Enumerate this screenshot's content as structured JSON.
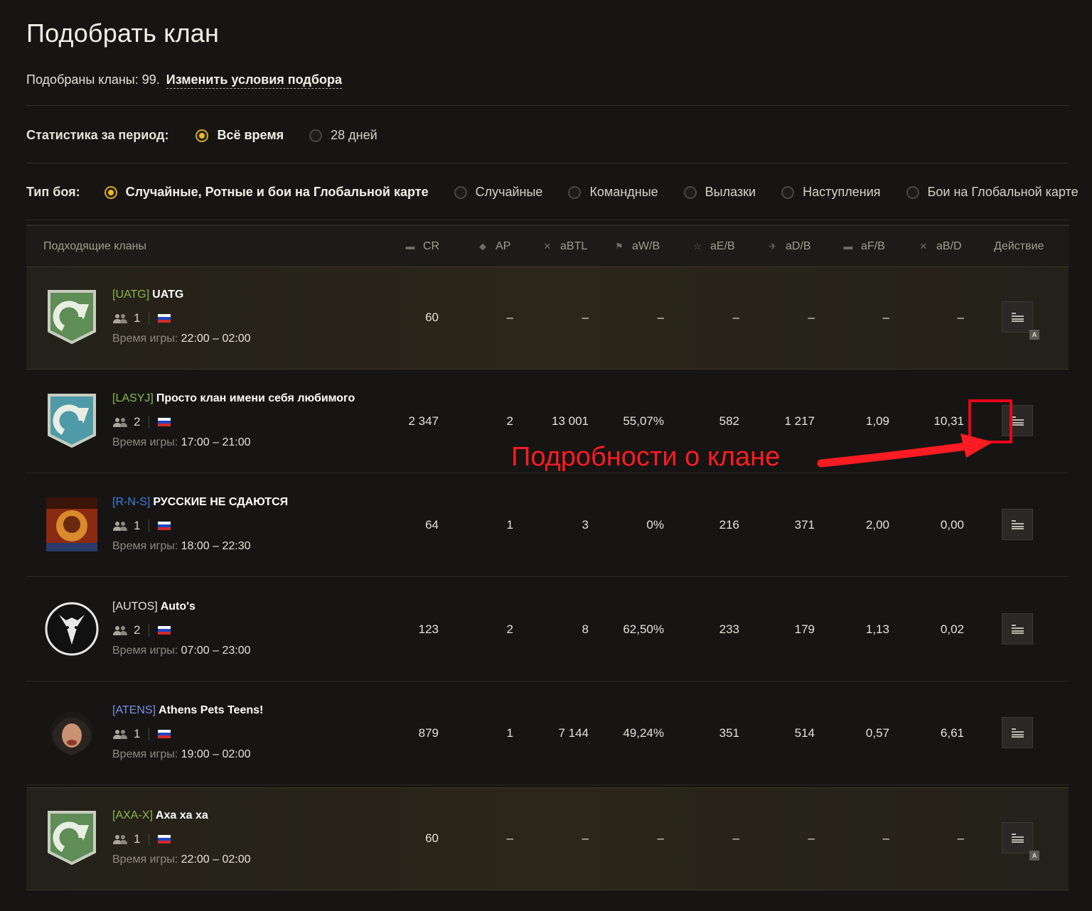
{
  "header": {
    "title": "Подобрать клан",
    "summary_prefix": "Подобраны кланы: 99.",
    "change_link": "Изменить условия подбора"
  },
  "period": {
    "label": "Статистика за период:",
    "options": [
      {
        "label": "Всё время",
        "checked": true
      },
      {
        "label": "28 дней",
        "checked": false
      }
    ]
  },
  "battle_type": {
    "label": "Тип боя:",
    "options": [
      {
        "label": "Случайные, Ротные и бои на Глобальной карте",
        "checked": true
      },
      {
        "label": "Случайные",
        "checked": false
      },
      {
        "label": "Командные",
        "checked": false
      },
      {
        "label": "Вылазки",
        "checked": false
      },
      {
        "label": "Наступления",
        "checked": false
      },
      {
        "label": "Бои на Глобальной карте",
        "checked": false
      }
    ]
  },
  "table": {
    "headers": {
      "clans": "Подходящие кланы",
      "cr": "CR",
      "ap": "AP",
      "abtl": "aBTL",
      "awb": "aW/B",
      "aeb": "aE/B",
      "adb": "aD/B",
      "afb": "aF/B",
      "abd": "aB/D",
      "action": "Действие"
    },
    "rows": [
      {
        "tag": "[UATG]",
        "name": "UATG",
        "tag_color": "#8ab84a",
        "members": "1",
        "time_label": "Время игры:",
        "time": "22:00 – 02:00",
        "cr": "60",
        "ap": "–",
        "abtl": "–",
        "awb": "–",
        "aeb": "–",
        "adb": "–",
        "afb": "–",
        "abd": "–",
        "highlight": true,
        "badge": "A",
        "emblem": "banner-green"
      },
      {
        "tag": "[LASYJ]",
        "name": "Просто клан имени себя любимого",
        "tag_color": "#8ab84a",
        "members": "2",
        "time_label": "Время игры:",
        "time": "17:00 – 21:00",
        "cr": "2 347",
        "ap": "2",
        "abtl": "13 001",
        "awb": "55,07%",
        "aeb": "582",
        "adb": "1 217",
        "afb": "1,09",
        "abd": "10,31",
        "highlight": false,
        "badge": "",
        "emblem": "banner-teal"
      },
      {
        "tag": "[R-N-S]",
        "name": "РУССКИЕ НЕ СДАЮТСЯ",
        "tag_color": "#3d7fe0",
        "members": "1",
        "time_label": "Время игры:",
        "time": "18:00 – 22:30",
        "cr": "64",
        "ap": "1",
        "abtl": "3",
        "awb": "0%",
        "aeb": "216",
        "adb": "371",
        "afb": "2,00",
        "abd": "0,00",
        "highlight": false,
        "badge": "",
        "emblem": "poster"
      },
      {
        "tag": "[AUTOS]",
        "name": "Auto's",
        "tag_color": "#e6e2d8",
        "members": "2",
        "time_label": "Время игры:",
        "time": "07:00 – 23:00",
        "cr": "123",
        "ap": "2",
        "abtl": "8",
        "awb": "62,50%",
        "aeb": "233",
        "adb": "179",
        "afb": "1,13",
        "abd": "0,02",
        "highlight": false,
        "badge": "",
        "emblem": "wolf"
      },
      {
        "tag": "[ATENS]",
        "name": "Athens Pets Teens!",
        "tag_color": "#7a8fe0",
        "members": "1",
        "time_label": "Время игры:",
        "time": "19:00 – 02:00",
        "cr": "879",
        "ap": "1",
        "abtl": "7 144",
        "awb": "49,24%",
        "aeb": "351",
        "adb": "514",
        "afb": "0,57",
        "abd": "6,61",
        "highlight": false,
        "badge": "",
        "emblem": "face"
      },
      {
        "tag": "[AXA-X]",
        "name": "Axa xa xa",
        "tag_color": "#8ab84a",
        "members": "1",
        "time_label": "Время игры:",
        "time": "22:00 – 02:00",
        "cr": "60",
        "ap": "–",
        "abtl": "–",
        "awb": "–",
        "aeb": "–",
        "adb": "–",
        "afb": "–",
        "abd": "–",
        "highlight": true,
        "badge": "A",
        "emblem": "banner-green"
      }
    ]
  },
  "annotation": {
    "text": "Подробности о клане",
    "color": "#ff1b22"
  },
  "colors": {
    "background": "#161513",
    "radio_accent": "#f0b71f",
    "highlight_row": "#2a2619"
  },
  "icons": [
    "people-icon",
    "flag-ru-icon",
    "details-list-icon",
    "tank-icon",
    "helmet-icon",
    "crossed-swords-icon",
    "star-icon",
    "plane-icon",
    "arrow-icon"
  ]
}
